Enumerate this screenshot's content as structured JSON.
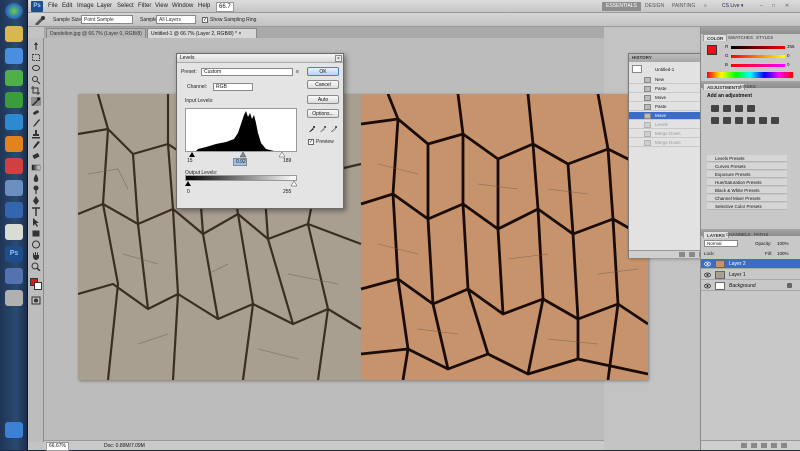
{
  "app": {
    "menus": [
      "File",
      "Edit",
      "Image",
      "Layer",
      "Select",
      "Filter",
      "View",
      "Window",
      "Help"
    ],
    "zoom_field": "66.7",
    "workspaces": [
      "ESSENTIALS",
      "DESIGN",
      "PAINTING"
    ],
    "cs_live": "CS Live ▾",
    "window_controls": [
      "–",
      "□",
      "✕"
    ]
  },
  "options_bar": {
    "sample_size_label": "Sample Size:",
    "sample_size_value": "Point Sample",
    "sample_label": "Sample:",
    "sample_value": "All Layers",
    "show_ring_label": "Show Sampling Ring"
  },
  "doc_tabs": [
    {
      "label": "Dandelion.jpg @ 66.7% (Layer 0, RGB/8) ×",
      "active": false
    },
    {
      "label": "Untitled-1 @ 66.7% (Layer 2, RGB/8) * ×",
      "active": true
    }
  ],
  "status": {
    "zoom": "66.67%",
    "doc": "Doc: 0.89M/7.09M"
  },
  "levels_dialog": {
    "title": "Levels",
    "preset_label": "Preset:",
    "preset_value": "Custom",
    "channel_label": "Channel:",
    "channel_value": "RGB",
    "input_label": "Input Levels:",
    "input_values": [
      "15",
      "0.92",
      "189"
    ],
    "output_label": "Output Levels:",
    "output_values": [
      "0",
      "255"
    ],
    "buttons": [
      "OK",
      "Cancel",
      "Auto",
      "Options..."
    ],
    "preview_label": "Preview",
    "preview_checked": true
  },
  "history_panel": {
    "title": "HISTORY",
    "snapshot": "Untitled-1",
    "steps": [
      {
        "label": "New",
        "state": "normal"
      },
      {
        "label": "Paste",
        "state": "normal"
      },
      {
        "label": "Move",
        "state": "normal"
      },
      {
        "label": "Paste",
        "state": "normal"
      },
      {
        "label": "Move",
        "state": "selected"
      },
      {
        "label": "Levels",
        "state": "dim"
      },
      {
        "label": "Merge Down",
        "state": "dim"
      },
      {
        "label": "Merge Down",
        "state": "dim"
      }
    ]
  },
  "color_panel": {
    "tabs": [
      "COLOR",
      "SWATCHES",
      "STYLES"
    ],
    "channels": [
      {
        "label": "R",
        "value": "255"
      },
      {
        "label": "G",
        "value": "0"
      },
      {
        "label": "B",
        "value": "0"
      }
    ]
  },
  "adjustments_panel": {
    "tabs": [
      "ADJUSTMENTS",
      "MASKS"
    ],
    "title": "Add an adjustment",
    "presets": [
      "Levels Presets",
      "Curves Presets",
      "Exposure Presets",
      "Hue/Saturation Presets",
      "Black & White Presets",
      "Channel Mixer Presets",
      "Selective Color Presets"
    ]
  },
  "layers_panel": {
    "tabs": [
      "LAYERS",
      "CHANNELS",
      "PATHS"
    ],
    "blend_mode": "Normal",
    "opacity_label": "Opacity:",
    "opacity_value": "100%",
    "lock_label": "Lock:",
    "fill_label": "Fill:",
    "fill_value": "100%",
    "layers": [
      {
        "name": "Layer 2",
        "selected": true
      },
      {
        "name": "Layer 1",
        "selected": false
      },
      {
        "name": "Background",
        "selected": false
      }
    ]
  },
  "colors": {
    "foreground": "#e2151b",
    "background": "#ffffff",
    "accent": "#3a6cc8"
  }
}
